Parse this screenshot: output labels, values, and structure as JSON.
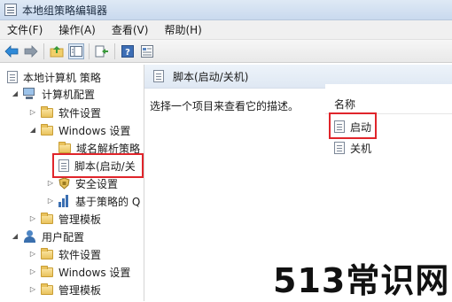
{
  "window": {
    "title": "本地组策略编辑器"
  },
  "menu": {
    "file": "文件(F)",
    "action": "操作(A)",
    "view": "查看(V)",
    "help": "帮助(H)"
  },
  "toolbar": {
    "icons": [
      "back-arrow-icon",
      "forward-arrow-icon",
      "up-folder-icon",
      "show-hide-tree-icon",
      "export-list-icon",
      "help-icon",
      "properties-icon"
    ]
  },
  "tree": {
    "root": "本地计算机 策略",
    "computer_config": "计算机配置",
    "software_settings": "软件设置",
    "windows_settings": "Windows 设置",
    "dns_policy": "域名解析策略",
    "scripts": "脚本(启动/关",
    "security_settings": "安全设置",
    "policy_qos": "基于策略的 Q",
    "admin_templates": "管理模板",
    "user_config": "用户配置",
    "user_software_settings": "软件设置",
    "user_windows_settings": "Windows 设置",
    "user_admin_templates": "管理模板"
  },
  "right": {
    "header": "脚本(启动/关机)",
    "description": "选择一个项目来查看它的描述。",
    "column_name": "名称",
    "items": [
      "启动",
      "关机"
    ]
  },
  "watermark": "513常识网",
  "colors": {
    "highlight_box": "#e0252b"
  }
}
